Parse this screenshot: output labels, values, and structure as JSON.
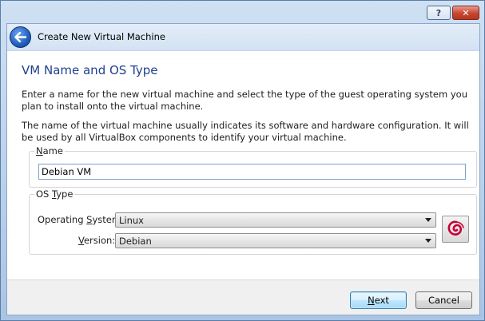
{
  "window": {
    "caption_help": "?",
    "caption_close": "✕"
  },
  "header": {
    "title": "Create New Virtual Machine"
  },
  "page": {
    "title": "VM Name and OS Type",
    "paragraph1": "Enter a name for the new virtual machine and select the type of the guest operating system you plan to install onto the virtual machine.",
    "paragraph2": "The name of the virtual machine usually indicates its software and hardware configuration. It will be used by all VirtualBox components to identify your virtual machine."
  },
  "name_group": {
    "legend_mnemonic": "N",
    "legend_rest": "ame",
    "value": "Debian VM"
  },
  "os_group": {
    "legend_prefix": "OS ",
    "legend_mnemonic": "T",
    "legend_rest": "ype",
    "os_label_prefix": "Operating ",
    "os_label_mnemonic": "S",
    "os_label_rest": "ystem:",
    "os_value": "Linux",
    "version_label_mnemonic": "V",
    "version_label_rest": "ersion:",
    "version_value": "Debian",
    "os_icon": "debian-swirl-icon"
  },
  "footer": {
    "next_mnemonic": "N",
    "next_rest": "ext",
    "cancel_label": "Cancel"
  },
  "colors": {
    "title_blue": "#1f3f8f",
    "debian_red": "#c70036"
  }
}
